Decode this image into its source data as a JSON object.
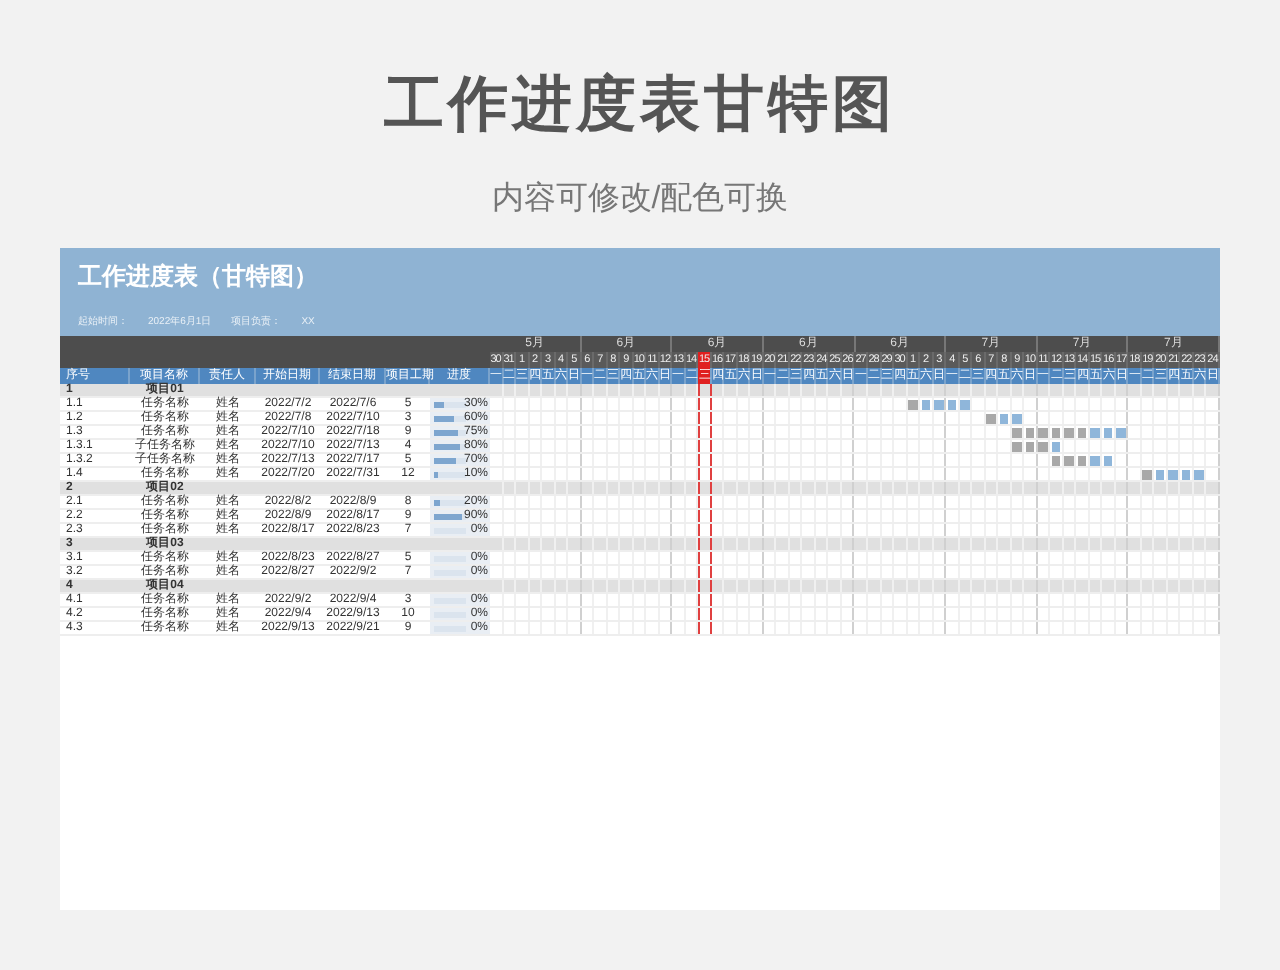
{
  "page_title": "工作进度表甘特图",
  "subtitle": "内容可修改/配色可换",
  "sheet": {
    "title": "工作进度表（甘特图）",
    "info": [
      {
        "label": "起始时间：",
        "value": "2022年6月1日"
      },
      {
        "label": "项目负责：",
        "value": "XX"
      }
    ],
    "weeks": [
      "5月",
      "6月",
      "6月",
      "6月",
      "6月",
      "7月",
      "7月",
      "7月"
    ],
    "days": [
      {
        "date": "30",
        "weekday": "一",
        "today": false
      },
      {
        "date": "31",
        "weekday": "二",
        "today": false
      },
      {
        "date": "1",
        "weekday": "三",
        "today": false
      },
      {
        "date": "2",
        "weekday": "四",
        "today": false
      },
      {
        "date": "3",
        "weekday": "五",
        "today": false
      },
      {
        "date": "4",
        "weekday": "六",
        "today": false
      },
      {
        "date": "5",
        "weekday": "日",
        "today": false
      },
      {
        "date": "6",
        "weekday": "一",
        "today": false
      },
      {
        "date": "7",
        "weekday": "二",
        "today": false
      },
      {
        "date": "8",
        "weekday": "三",
        "today": false
      },
      {
        "date": "9",
        "weekday": "四",
        "today": false
      },
      {
        "date": "10",
        "weekday": "五",
        "today": false
      },
      {
        "date": "11",
        "weekday": "六",
        "today": false
      },
      {
        "date": "12",
        "weekday": "日",
        "today": false
      },
      {
        "date": "13",
        "weekday": "一",
        "today": false
      },
      {
        "date": "14",
        "weekday": "二",
        "today": false
      },
      {
        "date": "15",
        "weekday": "三",
        "today": true
      },
      {
        "date": "16",
        "weekday": "四",
        "today": false
      },
      {
        "date": "17",
        "weekday": "五",
        "today": false
      },
      {
        "date": "18",
        "weekday": "六",
        "today": false
      },
      {
        "date": "19",
        "weekday": "日",
        "today": false
      },
      {
        "date": "20",
        "weekday": "一",
        "today": false
      },
      {
        "date": "21",
        "weekday": "二",
        "today": false
      },
      {
        "date": "22",
        "weekday": "三",
        "today": false
      },
      {
        "date": "23",
        "weekday": "四",
        "today": false
      },
      {
        "date": "24",
        "weekday": "五",
        "today": false
      },
      {
        "date": "25",
        "weekday": "六",
        "today": false
      },
      {
        "date": "26",
        "weekday": "日",
        "today": false
      },
      {
        "date": "27",
        "weekday": "一",
        "today": false
      },
      {
        "date": "28",
        "weekday": "二",
        "today": false
      },
      {
        "date": "29",
        "weekday": "三",
        "today": false
      },
      {
        "date": "30",
        "weekday": "四",
        "today": false
      },
      {
        "date": "1",
        "weekday": "五",
        "today": false
      },
      {
        "date": "2",
        "weekday": "六",
        "today": false
      },
      {
        "date": "3",
        "weekday": "日",
        "today": false
      },
      {
        "date": "4",
        "weekday": "一",
        "today": false
      },
      {
        "date": "5",
        "weekday": "二",
        "today": false
      },
      {
        "date": "6",
        "weekday": "三",
        "today": false
      },
      {
        "date": "7",
        "weekday": "四",
        "today": false
      },
      {
        "date": "8",
        "weekday": "五",
        "today": false
      },
      {
        "date": "9",
        "weekday": "六",
        "today": false
      },
      {
        "date": "10",
        "weekday": "日",
        "today": false
      },
      {
        "date": "11",
        "weekday": "一",
        "today": false
      },
      {
        "date": "12",
        "weekday": "二",
        "today": false
      },
      {
        "date": "13",
        "weekday": "三",
        "today": false
      },
      {
        "date": "14",
        "weekday": "四",
        "today": false
      },
      {
        "date": "15",
        "weekday": "五",
        "today": false
      },
      {
        "date": "16",
        "weekday": "六",
        "today": false
      },
      {
        "date": "17",
        "weekday": "日",
        "today": false
      },
      {
        "date": "18",
        "weekday": "一",
        "today": false
      },
      {
        "date": "19",
        "weekday": "二",
        "today": false
      },
      {
        "date": "20",
        "weekday": "三",
        "today": false
      },
      {
        "date": "21",
        "weekday": "四",
        "today": false
      },
      {
        "date": "22",
        "weekday": "五",
        "today": false
      },
      {
        "date": "23",
        "weekday": "六",
        "today": false
      },
      {
        "date": "24",
        "weekday": "日",
        "today": false
      }
    ],
    "columns": [
      "序号",
      "项目名称",
      "责任人",
      "开始日期",
      "结束日期",
      "项目工期",
      "进度"
    ],
    "rows": [
      {
        "kind": "group",
        "no": "1",
        "name": "项目01"
      },
      {
        "kind": "task",
        "no": "1.1",
        "name": "任务名称",
        "owner": "姓名",
        "start": "2022/7/2",
        "end": "2022/7/6",
        "duration": "5",
        "progress": "30%",
        "level": 0.3
      },
      {
        "kind": "task",
        "no": "1.2",
        "name": "任务名称",
        "owner": "姓名",
        "start": "2022/7/8",
        "end": "2022/7/10",
        "duration": "3",
        "progress": "60%",
        "level": 0.6
      },
      {
        "kind": "task",
        "no": "1.3",
        "name": "任务名称",
        "owner": "姓名",
        "start": "2022/7/10",
        "end": "2022/7/18",
        "duration": "9",
        "progress": "75%",
        "level": 0.75
      },
      {
        "kind": "task",
        "no": "1.3.1",
        "name": "子任务名称",
        "owner": "姓名",
        "start": "2022/7/10",
        "end": "2022/7/13",
        "duration": "4",
        "progress": "80%",
        "level": 0.8
      },
      {
        "kind": "task",
        "no": "1.3.2",
        "name": "子任务名称",
        "owner": "姓名",
        "start": "2022/7/13",
        "end": "2022/7/17",
        "duration": "5",
        "progress": "70%",
        "level": 0.7
      },
      {
        "kind": "task",
        "no": "1.4",
        "name": "任务名称",
        "owner": "姓名",
        "start": "2022/7/20",
        "end": "2022/7/31",
        "duration": "12",
        "progress": "10%",
        "level": 0.1
      },
      {
        "kind": "group",
        "no": "2",
        "name": "项目02"
      },
      {
        "kind": "task",
        "no": "2.1",
        "name": "任务名称",
        "owner": "姓名",
        "start": "2022/8/2",
        "end": "2022/8/9",
        "duration": "8",
        "progress": "20%",
        "level": 0.2
      },
      {
        "kind": "task",
        "no": "2.2",
        "name": "任务名称",
        "owner": "姓名",
        "start": "2022/8/9",
        "end": "2022/8/17",
        "duration": "9",
        "progress": "90%",
        "level": 0.9
      },
      {
        "kind": "task",
        "no": "2.3",
        "name": "任务名称",
        "owner": "姓名",
        "start": "2022/8/17",
        "end": "2022/8/23",
        "duration": "7",
        "progress": "0%",
        "level": 0
      },
      {
        "kind": "group",
        "no": "3",
        "name": "项目03"
      },
      {
        "kind": "task",
        "no": "3.1",
        "name": "任务名称",
        "owner": "姓名",
        "start": "2022/8/23",
        "end": "2022/8/27",
        "duration": "5",
        "progress": "0%",
        "level": 0
      },
      {
        "kind": "task",
        "no": "3.2",
        "name": "任务名称",
        "owner": "姓名",
        "start": "2022/8/27",
        "end": "2022/9/2",
        "duration": "7",
        "progress": "0%",
        "level": 0
      },
      {
        "kind": "group",
        "no": "4",
        "name": "项目04"
      },
      {
        "kind": "task",
        "no": "4.1",
        "name": "任务名称",
        "owner": "姓名",
        "start": "2022/9/2",
        "end": "2022/9/4",
        "duration": "3",
        "progress": "0%",
        "level": 0
      },
      {
        "kind": "task",
        "no": "4.2",
        "name": "任务名称",
        "owner": "姓名",
        "start": "2022/9/4",
        "end": "2022/9/13",
        "duration": "10",
        "progress": "0%",
        "level": 0
      },
      {
        "kind": "task",
        "no": "4.3",
        "name": "任务名称",
        "owner": "姓名",
        "start": "2022/9/13",
        "end": "2022/9/21",
        "duration": "9",
        "progress": "0%",
        "level": 0
      }
    ]
  }
}
